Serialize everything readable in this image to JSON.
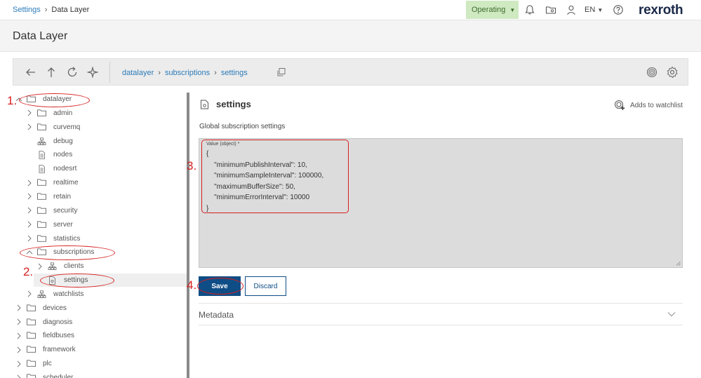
{
  "topbar": {
    "breadcrumb": [
      "Settings",
      "Data Layer"
    ],
    "status": "Operating",
    "language": "EN",
    "logo": "rexroth",
    "icons": [
      "bell-icon",
      "folder-settings-icon",
      "user-icon",
      "help-icon"
    ]
  },
  "page": {
    "title": "Data Layer"
  },
  "toolbar": {
    "path": [
      "datalayer",
      "subscriptions",
      "settings"
    ],
    "icons": [
      "arrow-left-icon",
      "arrow-up-icon",
      "refresh-icon",
      "sparkle-icon",
      "copy-icon",
      "watch-icon",
      "gear-icon"
    ]
  },
  "tree": [
    {
      "label": "datalayer",
      "type": "folder",
      "expanded": true
    },
    {
      "label": "admin",
      "type": "folder"
    },
    {
      "label": "curvemq",
      "type": "folder"
    },
    {
      "label": "debug",
      "type": "node"
    },
    {
      "label": "nodes",
      "type": "doc"
    },
    {
      "label": "nodesrt",
      "type": "doc"
    },
    {
      "label": "realtime",
      "type": "folder"
    },
    {
      "label": "retain",
      "type": "folder"
    },
    {
      "label": "security",
      "type": "folder"
    },
    {
      "label": "server",
      "type": "folder"
    },
    {
      "label": "statistics",
      "type": "folder"
    },
    {
      "label": "subscriptions",
      "type": "folder",
      "expanded": true
    },
    {
      "label": "clients",
      "type": "node"
    },
    {
      "label": "settings",
      "type": "settings",
      "selected": true
    },
    {
      "label": "watchlists",
      "type": "node"
    },
    {
      "label": "devices",
      "type": "folder"
    },
    {
      "label": "diagnosis",
      "type": "folder"
    },
    {
      "label": "fieldbuses",
      "type": "folder"
    },
    {
      "label": "framework",
      "type": "folder"
    },
    {
      "label": "plc",
      "type": "folder"
    },
    {
      "label": "scheduler",
      "type": "folder"
    }
  ],
  "panel": {
    "title": "settings",
    "watchlist_label": "Adds to watchlist",
    "subtitle": "Global subscription settings",
    "value_label": "Value (object) *",
    "value": "{\n    \"minimumPublishInterval\": 10,\n    \"minimumSampleInterval\": 100000,\n    \"maximumBufferSize\": 50,\n    \"minimumErrorInterval\": 10000\n}",
    "save_label": "Save",
    "discard_label": "Discard",
    "metadata_label": "Metadata"
  },
  "annotations": [
    "1.",
    "2.",
    "3.",
    "4."
  ],
  "colors": {
    "accent": "#0f4d86",
    "link": "#2b7bb9",
    "status_bg": "#cfe9c1",
    "annotation": "#d62020"
  }
}
